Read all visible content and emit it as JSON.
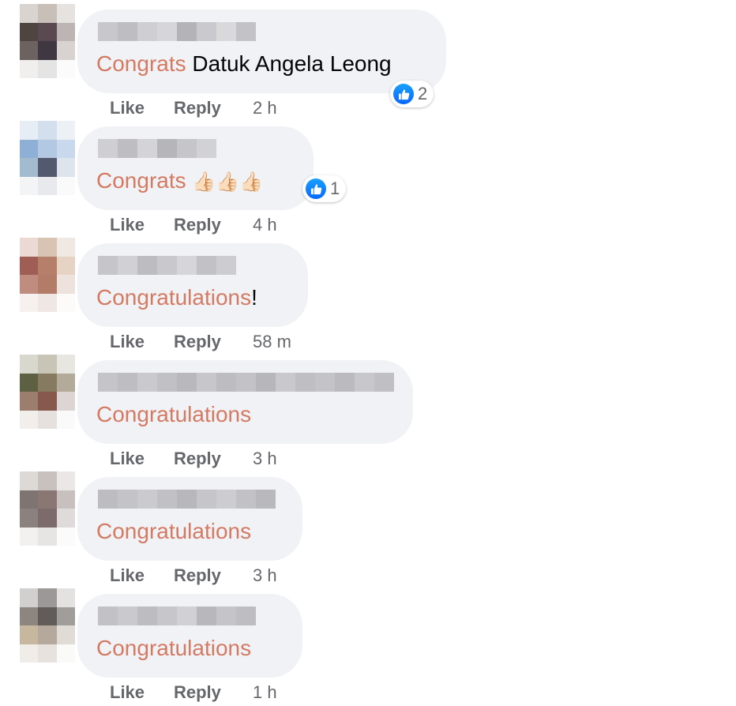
{
  "comments": [
    {
      "highlight": "Congrats",
      "rest": " Datuk Angela Leong",
      "reaction_count": "2",
      "like": "Like",
      "reply": "Reply",
      "time": "2 h"
    },
    {
      "highlight": "Congrats",
      "rest": "",
      "emoji": "👍🏻👍🏻👍🏻",
      "reaction_count": "1",
      "like": "Like",
      "reply": "Reply",
      "time": "4 h"
    },
    {
      "highlight": "Congratulations",
      "rest": "!",
      "like": "Like",
      "reply": "Reply",
      "time": "58 m"
    },
    {
      "highlight": "Congratulations",
      "rest": "",
      "like": "Like",
      "reply": "Reply",
      "time": "3 h"
    },
    {
      "highlight": "Congratulations",
      "rest": "",
      "like": "Like",
      "reply": "Reply",
      "time": "3 h"
    },
    {
      "highlight": "Congratulations",
      "rest": "",
      "like": "Like",
      "reply": "Reply",
      "time": "1 h"
    }
  ],
  "colors": {
    "highlight": "#d47a62",
    "bubble": "#f0f2f5",
    "meta": "#65676b",
    "like_blue": "#0866ff"
  },
  "icons": {
    "reaction": "like-thumb-icon"
  }
}
